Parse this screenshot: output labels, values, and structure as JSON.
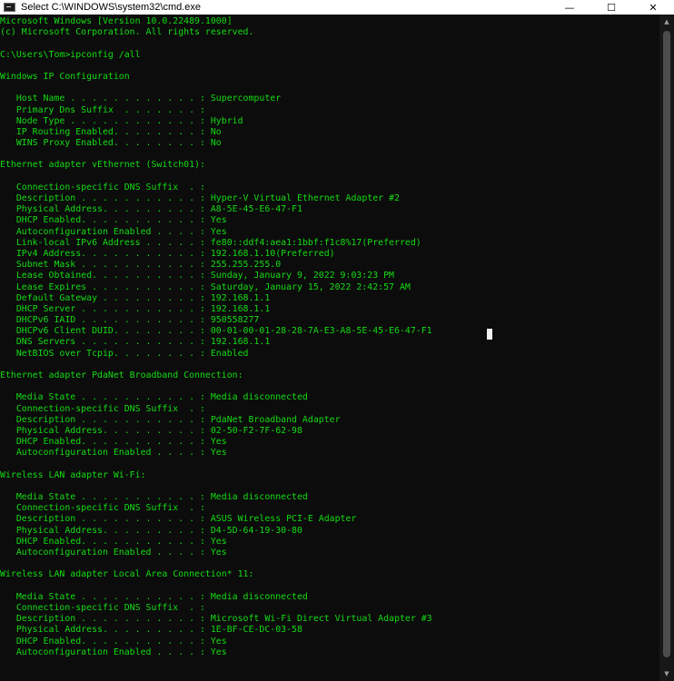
{
  "window": {
    "title": "Select C:\\WINDOWS\\system32\\cmd.exe",
    "minimize_glyph": "—",
    "maximize_glyph": "☐",
    "close_glyph": "✕",
    "icon": "cmd-icon"
  },
  "scrollbar": {
    "up_glyph": "▲",
    "down_glyph": "▼"
  },
  "colors": {
    "background": "#0c0c0c",
    "text": "#13dc13",
    "titlebar": "#ffffff"
  },
  "terminal": {
    "lines": [
      "Microsoft Windows [Version 10.0.22489.1000]",
      "(c) Microsoft Corporation. All rights reserved.",
      "",
      "C:\\Users\\Tom>ipconfig /all",
      "",
      "Windows IP Configuration",
      "",
      "   Host Name . . . . . . . . . . . . : Supercomputer",
      "   Primary Dns Suffix  . . . . . . . :",
      "   Node Type . . . . . . . . . . . . : Hybrid",
      "   IP Routing Enabled. . . . . . . . : No",
      "   WINS Proxy Enabled. . . . . . . . : No",
      "",
      "Ethernet adapter vEthernet (Switch01):",
      "",
      "   Connection-specific DNS Suffix  . :",
      "   Description . . . . . . . . . . . : Hyper-V Virtual Ethernet Adapter #2",
      "   Physical Address. . . . . . . . . : A8-5E-45-E6-47-F1",
      "   DHCP Enabled. . . . . . . . . . . : Yes",
      "   Autoconfiguration Enabled . . . . : Yes",
      "   Link-local IPv6 Address . . . . . : fe80::ddf4:aea1:1bbf:f1c8%17(Preferred)",
      "   IPv4 Address. . . . . . . . . . . : 192.168.1.10(Preferred)",
      "   Subnet Mask . . . . . . . . . . . : 255.255.255.0",
      "   Lease Obtained. . . . . . . . . . : Sunday, January 9, 2022 9:03:23 PM",
      "   Lease Expires . . . . . . . . . . : Saturday, January 15, 2022 2:42:57 AM",
      "   Default Gateway . . . . . . . . . : 192.168.1.1",
      "   DHCP Server . . . . . . . . . . . : 192.168.1.1",
      "   DHCPv6 IAID . . . . . . . . . . . : 950558277",
      "   DHCPv6 Client DUID. . . . . . . . : 00-01-00-01-28-28-7A-E3-A8-5E-45-E6-47-F1",
      "   DNS Servers . . . . . . . . . . . : 192.168.1.1",
      "   NetBIOS over Tcpip. . . . . . . . : Enabled",
      "",
      "Ethernet adapter PdaNet Broadband Connection:",
      "",
      "   Media State . . . . . . . . . . . : Media disconnected",
      "   Connection-specific DNS Suffix  . :",
      "   Description . . . . . . . . . . . : PdaNet Broadband Adapter",
      "   Physical Address. . . . . . . . . : 02-50-F2-7F-62-98",
      "   DHCP Enabled. . . . . . . . . . . : Yes",
      "   Autoconfiguration Enabled . . . . : Yes",
      "",
      "Wireless LAN adapter Wi-Fi:",
      "",
      "   Media State . . . . . . . . . . . : Media disconnected",
      "   Connection-specific DNS Suffix  . :",
      "   Description . . . . . . . . . . . : ASUS Wireless PCI-E Adapter",
      "   Physical Address. . . . . . . . . : D4-5D-64-19-30-80",
      "   DHCP Enabled. . . . . . . . . . . : Yes",
      "   Autoconfiguration Enabled . . . . : Yes",
      "",
      "Wireless LAN adapter Local Area Connection* 11:",
      "",
      "   Media State . . . . . . . . . . . : Media disconnected",
      "   Connection-specific DNS Suffix  . :",
      "   Description . . . . . . . . . . . : Microsoft Wi-Fi Direct Virtual Adapter #3",
      "   Physical Address. . . . . . . . . : 1E-BF-CE-DC-03-58",
      "   DHCP Enabled. . . . . . . . . . . : Yes",
      "   Autoconfiguration Enabled . . . . : Yes"
    ]
  }
}
